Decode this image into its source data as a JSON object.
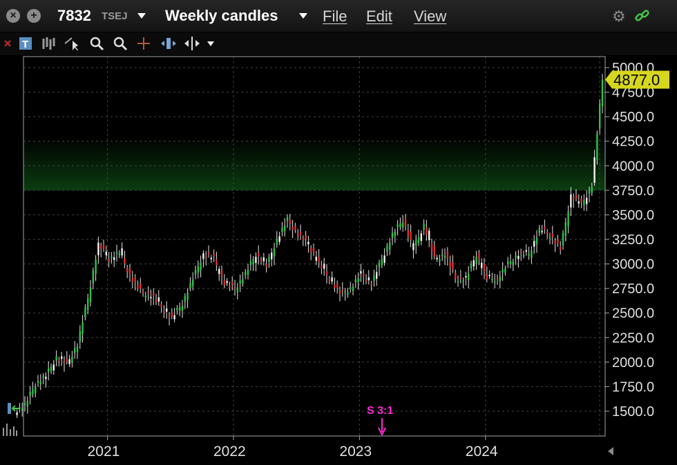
{
  "window": {
    "symbol": "7832",
    "exchange": "TSEJ",
    "period": "Weekly candles",
    "menus": [
      "File",
      "Edit",
      "View"
    ]
  },
  "colors": {
    "up": "#31c24a",
    "down": "#e03232",
    "neutral": "#f2f2f2",
    "price_tag": "#d6d61e",
    "annotation": "#ff2ad4",
    "zone": "#0b3d10"
  },
  "icons": [
    "close-icon",
    "add-icon",
    "gear-icon",
    "link-icon",
    "text-tool-icon",
    "bars-icon",
    "cursor-icon",
    "zoom-in-icon",
    "zoom-out-icon",
    "crosshair-icon",
    "pan-icon",
    "split-icon",
    "dropdown-icon"
  ],
  "chart_data": {
    "type": "candlestick",
    "ylim": [
      1250,
      5250
    ],
    "y_ticks": [
      "5000.0",
      "4750.0",
      "4500.0",
      "4250.0",
      "4000.0",
      "3750.0",
      "3500.0",
      "3250.0",
      "3000.0",
      "2750.0",
      "2500.0",
      "2250.0",
      "2000.0",
      "1750.0",
      "1500.0"
    ],
    "x_ticks": [
      "2021",
      "2022",
      "2023",
      "2024"
    ],
    "last_price": "4877.0",
    "zone": [
      3750,
      4300
    ],
    "split_annotation": "S 3:1",
    "series": [
      {
        "date": "2020-05",
        "close": 1560
      },
      {
        "date": "2020-06",
        "close": 1780
      },
      {
        "date": "2020-07",
        "close": 1860
      },
      {
        "date": "2020-08",
        "close": 2050
      },
      {
        "date": "2020-09",
        "close": 1980
      },
      {
        "date": "2020-10",
        "close": 2180
      },
      {
        "date": "2020-11",
        "close": 2650
      },
      {
        "date": "2020-12",
        "close": 3200
      },
      {
        "date": "2021-01",
        "close": 3050
      },
      {
        "date": "2021-02",
        "close": 3120
      },
      {
        "date": "2021-03",
        "close": 2880
      },
      {
        "date": "2021-04",
        "close": 2720
      },
      {
        "date": "2021-05",
        "close": 2680
      },
      {
        "date": "2021-06",
        "close": 2560
      },
      {
        "date": "2021-07",
        "close": 2450
      },
      {
        "date": "2021-08",
        "close": 2600
      },
      {
        "date": "2021-09",
        "close": 2850
      },
      {
        "date": "2021-10",
        "close": 3100
      },
      {
        "date": "2021-11",
        "close": 3050
      },
      {
        "date": "2021-12",
        "close": 2800
      },
      {
        "date": "2022-01",
        "close": 2750
      },
      {
        "date": "2022-02",
        "close": 2900
      },
      {
        "date": "2022-03",
        "close": 3100
      },
      {
        "date": "2022-04",
        "close": 2980
      },
      {
        "date": "2022-05",
        "close": 3250
      },
      {
        "date": "2022-06",
        "close": 3450
      },
      {
        "date": "2022-07",
        "close": 3300
      },
      {
        "date": "2022-08",
        "close": 3200
      },
      {
        "date": "2022-09",
        "close": 3000
      },
      {
        "date": "2022-10",
        "close": 2850
      },
      {
        "date": "2022-11",
        "close": 2700
      },
      {
        "date": "2022-12",
        "close": 2750
      },
      {
        "date": "2023-01",
        "close": 2900
      },
      {
        "date": "2023-02",
        "close": 2800
      },
      {
        "date": "2023-03",
        "close": 3050
      },
      {
        "date": "2023-04",
        "close": 3300
      },
      {
        "date": "2023-05",
        "close": 3450
      },
      {
        "date": "2023-06",
        "close": 3150
      },
      {
        "date": "2023-07",
        "close": 3400
      },
      {
        "date": "2023-08",
        "close": 3050
      },
      {
        "date": "2023-09",
        "close": 3100
      },
      {
        "date": "2023-10",
        "close": 2850
      },
      {
        "date": "2023-11",
        "close": 2850
      },
      {
        "date": "2023-12",
        "close": 3100
      },
      {
        "date": "2024-01",
        "close": 2850
      },
      {
        "date": "2024-02",
        "close": 2850
      },
      {
        "date": "2024-03",
        "close": 3000
      },
      {
        "date": "2024-04",
        "close": 3100
      },
      {
        "date": "2024-05",
        "close": 3100
      },
      {
        "date": "2024-06",
        "close": 3350
      },
      {
        "date": "2024-07",
        "close": 3300
      },
      {
        "date": "2024-08",
        "close": 3150
      },
      {
        "date": "2024-09",
        "close": 3700
      },
      {
        "date": "2024-10",
        "close": 3600
      },
      {
        "date": "2024-11",
        "close": 3800
      },
      {
        "date": "2024-12",
        "close": 4877
      }
    ]
  }
}
